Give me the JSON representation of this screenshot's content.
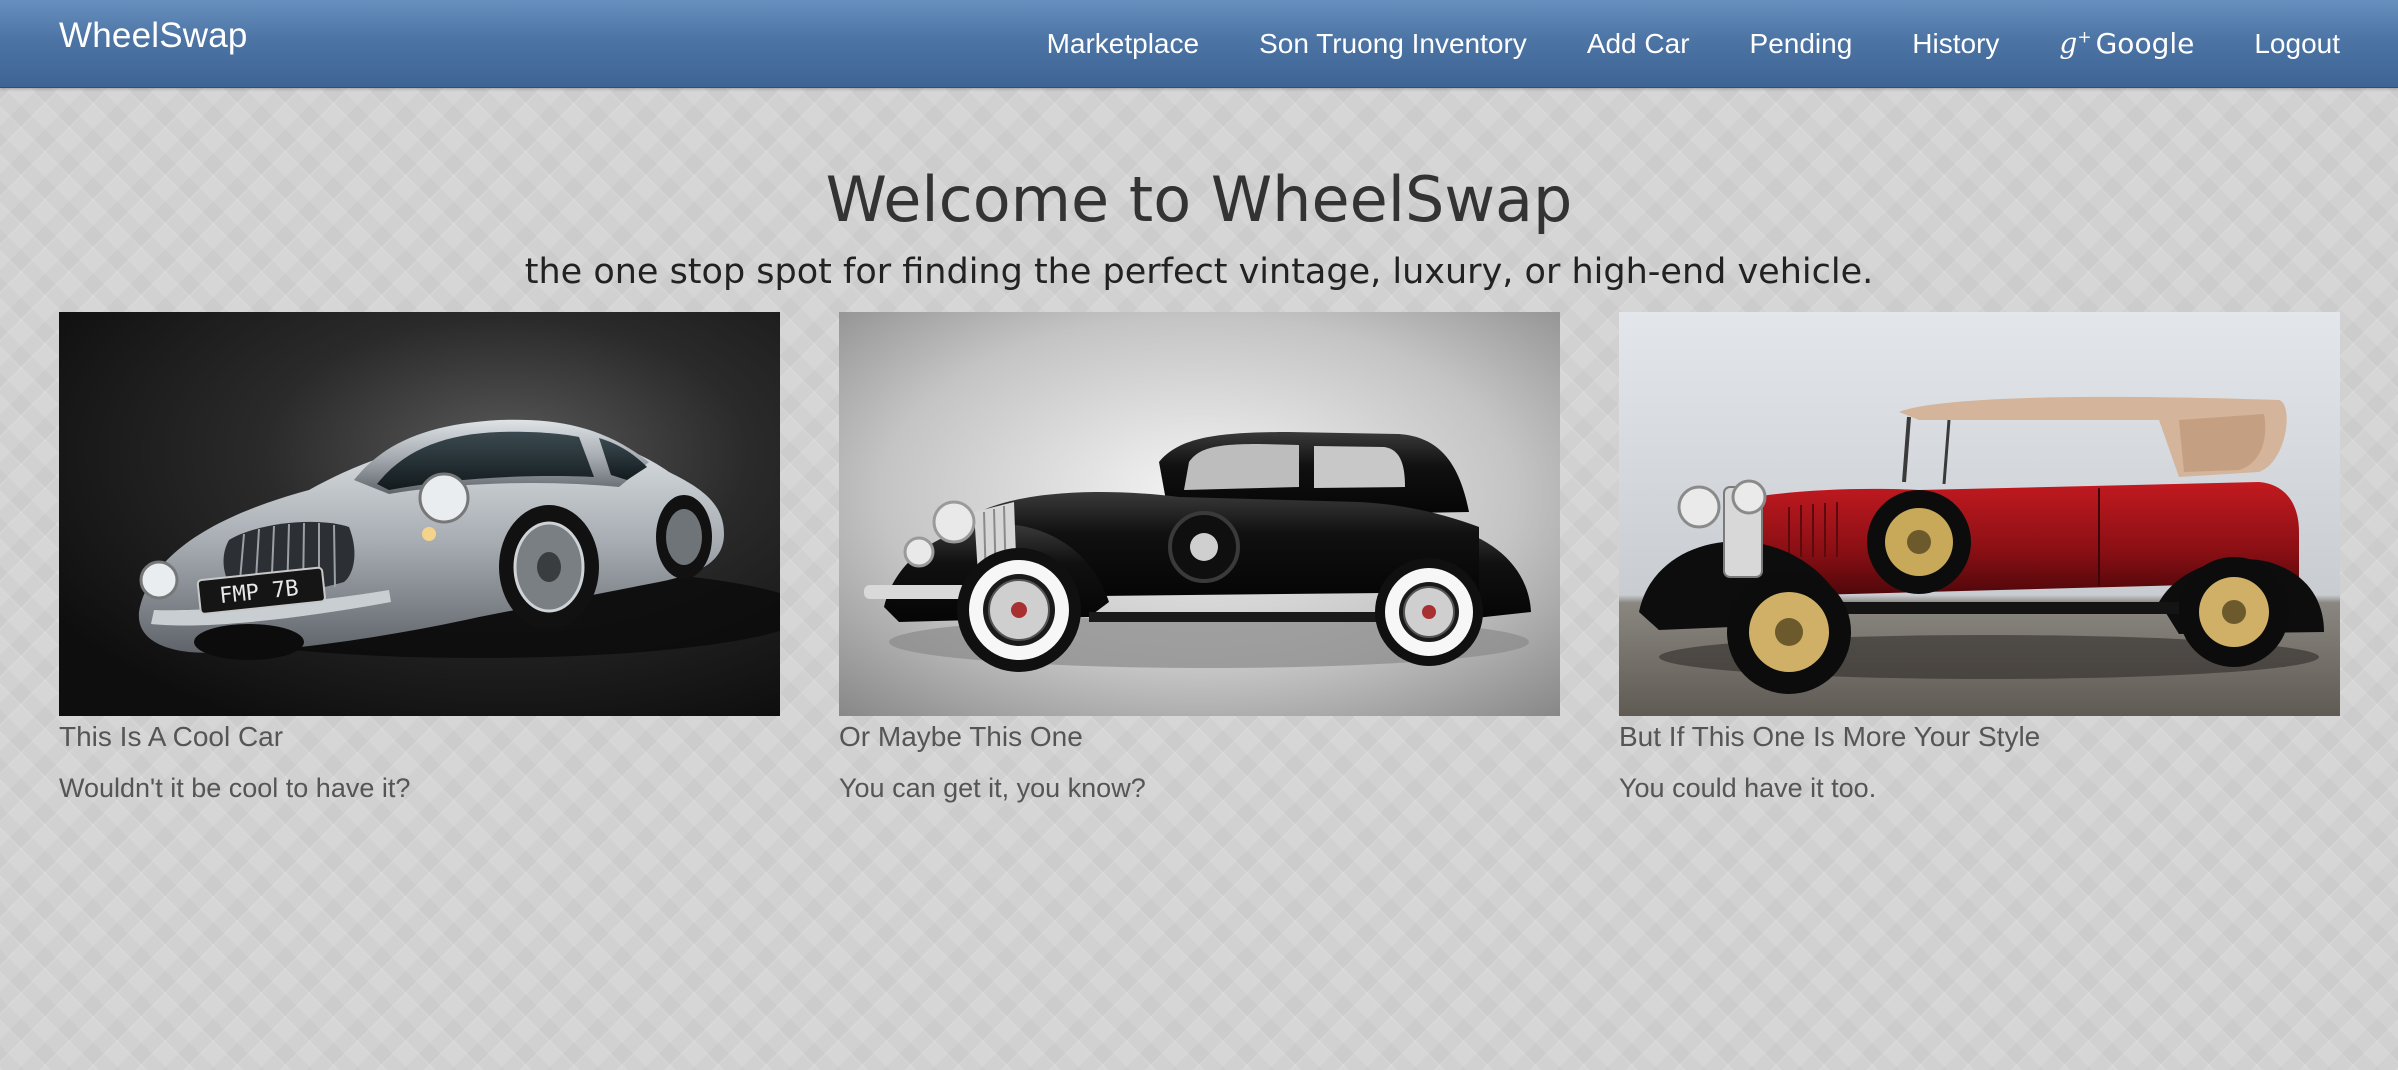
{
  "navbar": {
    "brand": "WheelSwap",
    "items": [
      {
        "label": "Marketplace"
      },
      {
        "label": "Son Truong Inventory"
      },
      {
        "label": "Add Car"
      },
      {
        "label": "Pending"
      },
      {
        "label": "History"
      },
      {
        "label": "Google",
        "icon": "google-plus-icon"
      },
      {
        "label": "Logout"
      }
    ]
  },
  "hero": {
    "title": "Welcome to WheelSwap",
    "subtitle": "the one stop spot for finding the perfect vintage, luxury, or high-end vehicle."
  },
  "cards": [
    {
      "title": "This Is A Cool Car",
      "text": "Wouldn't it be cool to have it?",
      "image": {
        "subject": "silver-sports-car",
        "plate": "FMP 7B",
        "background": "#1a1a1a",
        "body_color": "#a9afb5"
      }
    },
    {
      "title": "Or Maybe This One",
      "text": "You can get it, you know?",
      "image": {
        "subject": "black-vintage-coupe",
        "background": "#9a9a9a",
        "body_color": "#0d0d0d"
      }
    },
    {
      "title": "But If This One Is More Your Style",
      "text": "You could have it too.",
      "image": {
        "subject": "red-vintage-touring-car",
        "background": "#d7dbe0",
        "body_color": "#8c1014"
      }
    }
  ]
}
